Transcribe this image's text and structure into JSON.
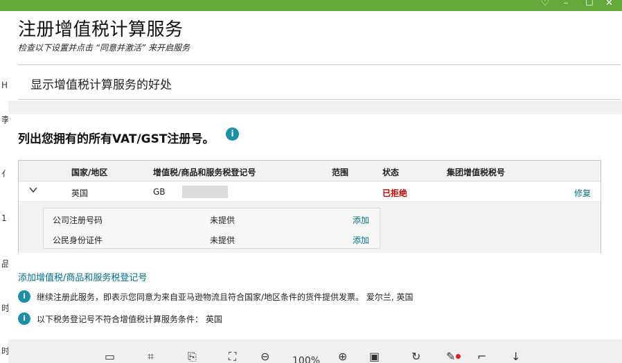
{
  "window": {
    "controls": [
      "♡",
      "–",
      "☐",
      "✕"
    ],
    "bg_letters": [
      "H",
      "李",
      "亻",
      "1",
      "品",
      "时",
      "时"
    ]
  },
  "header": {
    "title": "注册增值税计算服务",
    "subtitle": "检查以下设置并点击 “同意并激活” 来开启服务"
  },
  "benefits": {
    "label": "显示增值税计算服务的好处"
  },
  "registrations": {
    "heading": "列出您拥有的所有VAT/GST注册号。",
    "columns": {
      "country": "国家/地区",
      "vat_number": "增值税/商品和服务税登记号",
      "scope": "范围",
      "status": "状态",
      "group_vat": "集团增值税税号"
    },
    "row": {
      "country": "英国",
      "vat_number": "GB",
      "status": "已拒绝",
      "action": "修复"
    },
    "details": [
      {
        "label": "公司注册号码",
        "value": "未提供",
        "action": "添加"
      },
      {
        "label": "公民身份证件",
        "value": "未提供",
        "action": "添加"
      }
    ]
  },
  "add_link": "添加增值税/商品和服务税登记号",
  "notices": [
    "继续注册此服务，即表示您同意为来自亚马逊物流且符合国家/地区条件的货件提供发票。 爱尔兰, 英国",
    "以下税务登记号不符合增值税计算服务条件： 英国"
  ],
  "toolbar": {
    "zoom": "100%"
  },
  "colors": {
    "top_bar": "#64a83c",
    "link": "#006f84",
    "rejected": "#c00000",
    "info": "#1f8fa8"
  }
}
